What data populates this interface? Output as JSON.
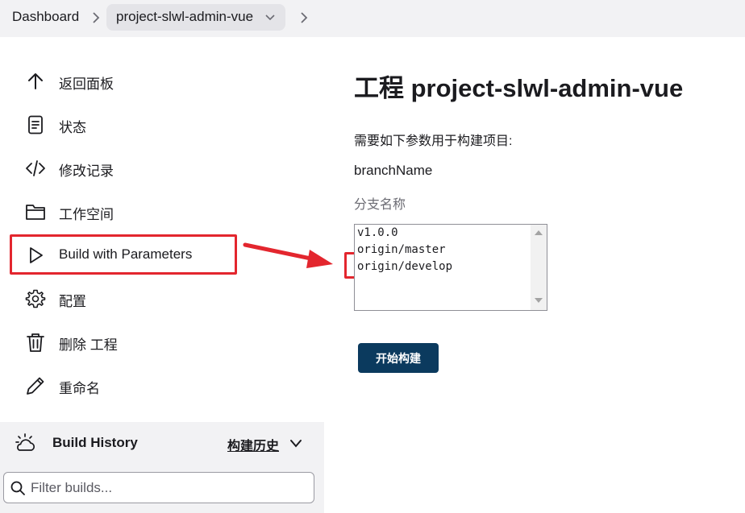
{
  "breadcrumb": {
    "dashboard": "Dashboard",
    "project": "project-slwl-admin-vue"
  },
  "sidebar": {
    "items": [
      {
        "label": "返回面板",
        "icon": "arrow-up-icon"
      },
      {
        "label": "状态",
        "icon": "document-icon"
      },
      {
        "label": "修改记录",
        "icon": "code-icon"
      },
      {
        "label": "工作空间",
        "icon": "folder-icon"
      },
      {
        "label": "Build with Parameters",
        "icon": "play-icon"
      },
      {
        "label": "配置",
        "icon": "gear-icon"
      },
      {
        "label": "删除 工程",
        "icon": "trash-icon"
      },
      {
        "label": "重命名",
        "icon": "pencil-icon"
      }
    ]
  },
  "build_history": {
    "title": "Build History",
    "link": "构建历史",
    "filter_placeholder": "Filter builds..."
  },
  "main": {
    "title": "工程 project-slwl-admin-vue",
    "params_intro": "需要如下参数用于构建项目:",
    "param_name": "branchName",
    "param_desc": "分支名称",
    "options": [
      "v1.0.0",
      "origin/master",
      "origin/develop"
    ],
    "build_button": "开始构建"
  },
  "colors": {
    "accent": "#0b3a5e",
    "annotation": "#e3262e",
    "breadcrumb_bg": "#f2f2f4"
  }
}
